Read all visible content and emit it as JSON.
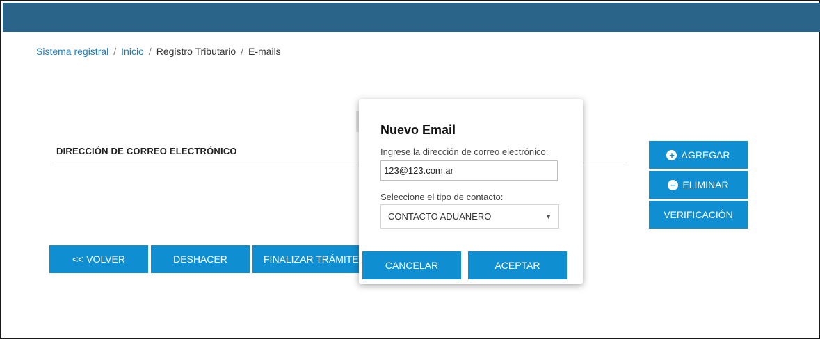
{
  "breadcrumb": {
    "items": [
      "Sistema registral",
      "Inicio",
      "Registro Tributario",
      "E-mails"
    ],
    "separator": "/"
  },
  "section": {
    "title": "DIRECCIÓN DE CORREO ELECTRÓNICO"
  },
  "side_actions": {
    "agregar": "AGREGAR",
    "eliminar": "ELIMINAR",
    "verificacion": "VERIFICACIÓN",
    "agregar_icon": "plus-circle-icon",
    "eliminar_icon": "minus-circle-icon"
  },
  "footer_actions": {
    "volver": "<< VOLVER",
    "deshacer": "DESHACER",
    "finalizar": "FINALIZAR TRÁMITE"
  },
  "modal": {
    "title": "Nuevo Email",
    "email_label": "Ingrese la dirección de correo electrónico:",
    "email_value": "123@123.com.ar",
    "contact_label": "Seleccione el tipo de contacto:",
    "contact_selected": "CONTACTO ADUANERO",
    "cancel": "CANCELAR",
    "accept": "ACEPTAR"
  },
  "colors": {
    "header": "#2a6488",
    "button": "#0f8fd1",
    "link": "#1f7dbf"
  }
}
